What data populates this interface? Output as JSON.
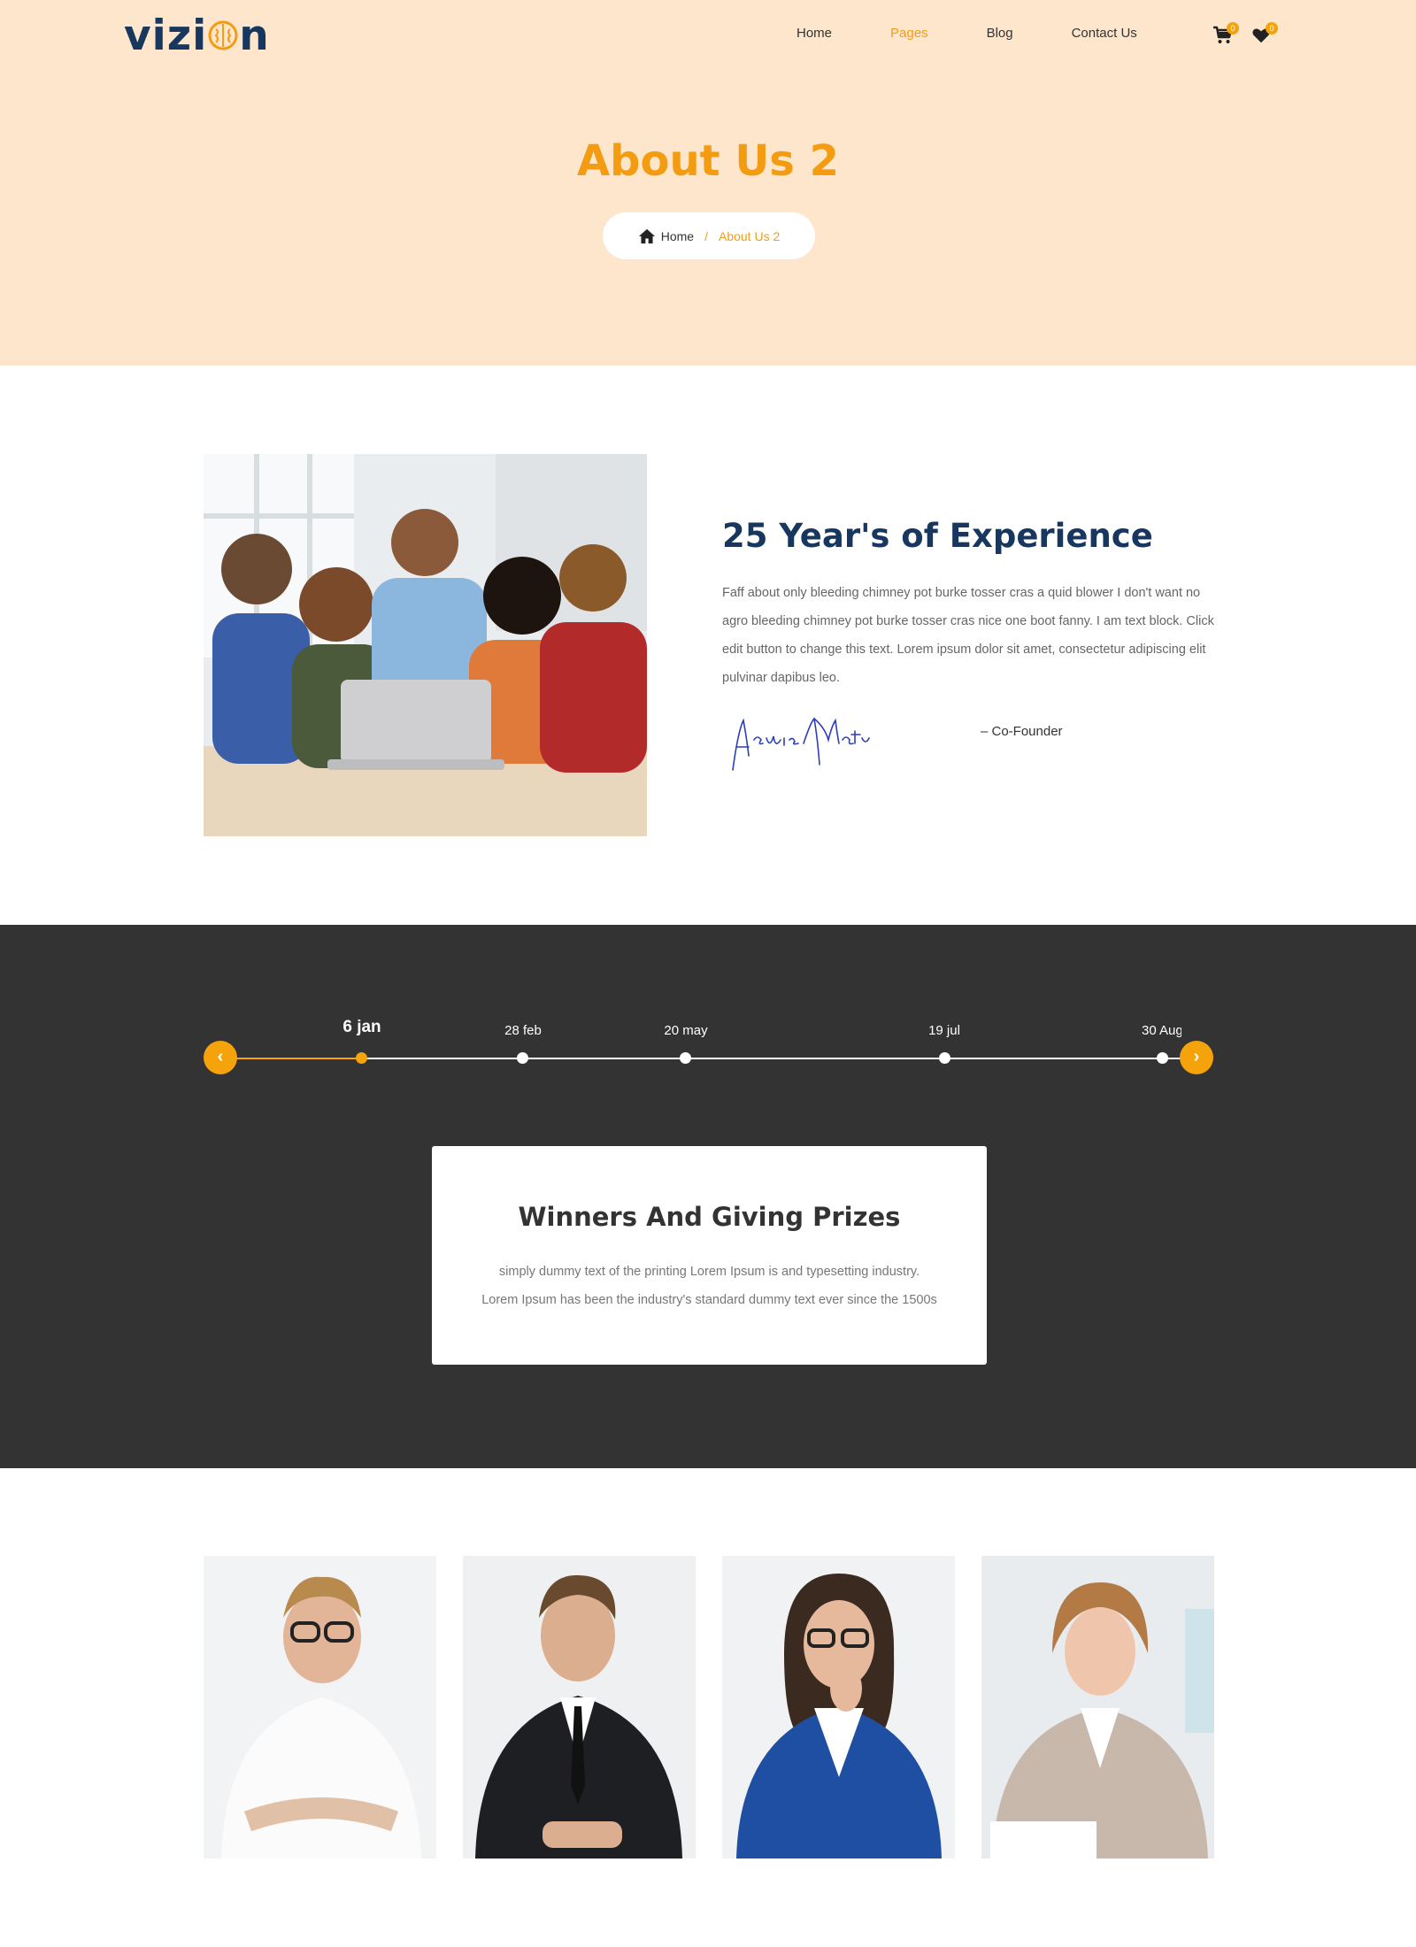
{
  "header": {
    "logo_text": "vizion",
    "nav": [
      {
        "label": "Home",
        "active": false
      },
      {
        "label": "Pages",
        "active": true
      },
      {
        "label": "Blog",
        "active": false
      },
      {
        "label": "Contact Us",
        "active": false
      }
    ],
    "cart_count": "0",
    "wishlist_count": "0",
    "accent_color": "#f39c12",
    "brand_color": "#17375e"
  },
  "hero": {
    "title": "About Us 2",
    "breadcrumb": {
      "home": "Home",
      "separator": "/",
      "current": "About Us 2"
    },
    "background": "#fde6cb"
  },
  "about": {
    "title": "25 Year's of Experience",
    "text": "Faff about only bleeding chimney pot burke tosser cras a quid blower I don't want no agro bleeding chimney pot burke tosser cras nice one boot fanny. I am text block. Click edit button to change this text. Lorem ipsum dolor sit amet, consectetur adipiscing elit pulvinar dapibus leo.",
    "signature": "Azmish Martin",
    "role": "– Co-Founder"
  },
  "timeline": {
    "dates": [
      "6 jan",
      "28 feb",
      "20 may",
      "19 jul",
      "30 Aug"
    ],
    "active_index": 0,
    "prev_icon": "chevron-left-icon",
    "next_icon": "chevron-right-icon",
    "event": {
      "title": "Winners And Giving Prizes",
      "line1": "simply dummy text of the printing Lorem Ipsum is and typesetting industry.",
      "line2": "Lorem Ipsum has been the industry's standard dummy text ever since the 1500s"
    }
  },
  "team": {
    "members": [
      {
        "photo": "man-glasses-white-shirt"
      },
      {
        "photo": "man-black-suit-phone"
      },
      {
        "photo": "woman-glasses-blue-blazer"
      },
      {
        "photo": "woman-beige-blazer"
      }
    ]
  }
}
